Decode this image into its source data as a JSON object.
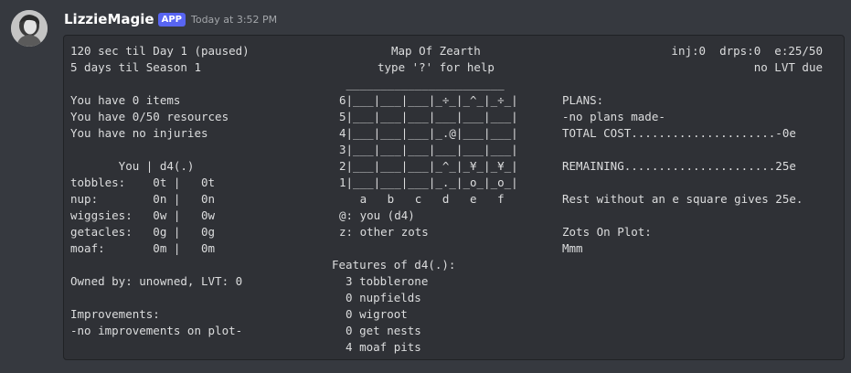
{
  "author": {
    "username": "LizzieMagie",
    "badge": "APP",
    "timestamp": "Today at 3:52 PM",
    "avatar_icon": "avatar-portrait-icon"
  },
  "game": {
    "status_top_left": "120 sec til Day 1 (paused)",
    "status_season": "5 days til Season 1",
    "map_title": "Map Of Zearth",
    "map_help": "type '?' for help",
    "stats_top_right": "inj:0  drps:0  e:25/50",
    "lvt_status": "no LVT due",
    "items": "You have 0 items",
    "resources": "You have 0/50 resources",
    "injuries": "You have no injuries",
    "resource_table_header": "       You | d4(.)",
    "resource_rows": [
      "tobbles:    0t |   0t",
      "nup:        0n |   0n",
      "wiggsies:   0w |   0w",
      "getacles:   0g |   0g",
      "moaf:       0m |   0m"
    ],
    "owned_by": "Owned by: unowned, LVT: 0",
    "improvements_label": "Improvements:",
    "improvements_none": "-no improvements on plot-",
    "map_rows": [
      " _______________________",
      "6|___|___|___|_÷_|_^_|_÷_|",
      "5|___|___|___|___|___|___|",
      "4|___|___|___|_.@|___|___|",
      "3|___|___|___|___|___|___|",
      "2|___|___|___|_^_|_¥_|_¥_|",
      "1|___|___|___|_._|_o_|_o_|",
      "   a   b   c   d   e   f",
      "@: you (d4)",
      "z: other zots"
    ],
    "features_header": "Features of d4(.):",
    "features": [
      "  3 tobblerone",
      "  0 nupfields",
      "  0 wigroot",
      "  0 get nests",
      "  4 moaf pits"
    ],
    "plans_label": "PLANS:",
    "plans_none": "-no plans made-",
    "total_cost": "TOTAL COST.....................-0e",
    "remaining": "REMAINING......................25e",
    "rest_note": "Rest without an e square gives 25e.",
    "zots_label": "Zots On Plot:",
    "zots_value": "Mmm"
  },
  "colors": {
    "background": "#36393f",
    "codeblock_bg": "#2f3136",
    "codeblock_border": "#202225",
    "text": "#dcddde",
    "badge": "#5865f2",
    "timestamp": "#a3a6aa"
  }
}
